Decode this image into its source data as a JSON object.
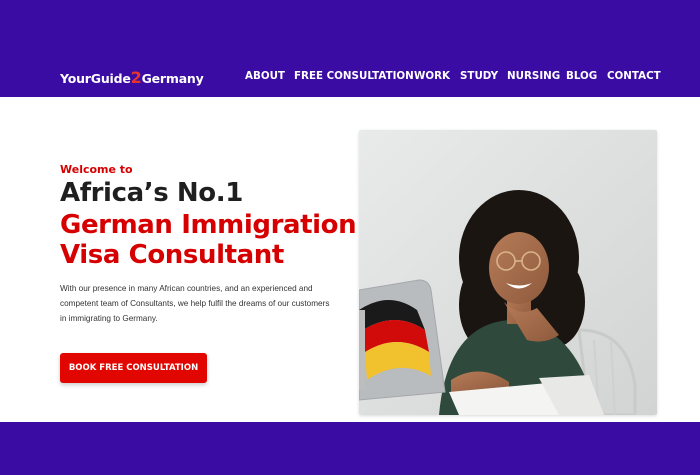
{
  "header": {
    "logo": {
      "part1": "YourGuide",
      "part2": "2",
      "part3": "Germany"
    },
    "nav": [
      "ABOUT",
      "FREE CONSULTATION",
      "WORK",
      "STUDY",
      "NURSING",
      "BLOG",
      "CONTACT"
    ]
  },
  "hero": {
    "welcome": "Welcome to",
    "title_line1": "Africa’s No.1",
    "title_line2": "German Immigration",
    "title_line3": "Visa Consultant",
    "description": "With our presence in many African countries, and an experienced and competent team of Consultants, we help fulfil the dreams of our customers in immigrating to Germany.",
    "cta_label": "BOOK FREE CONSULTATION"
  },
  "colors": {
    "brand_purple": "#3a0ca3",
    "accent_red": "#d60000",
    "cta_red": "#e10600"
  }
}
